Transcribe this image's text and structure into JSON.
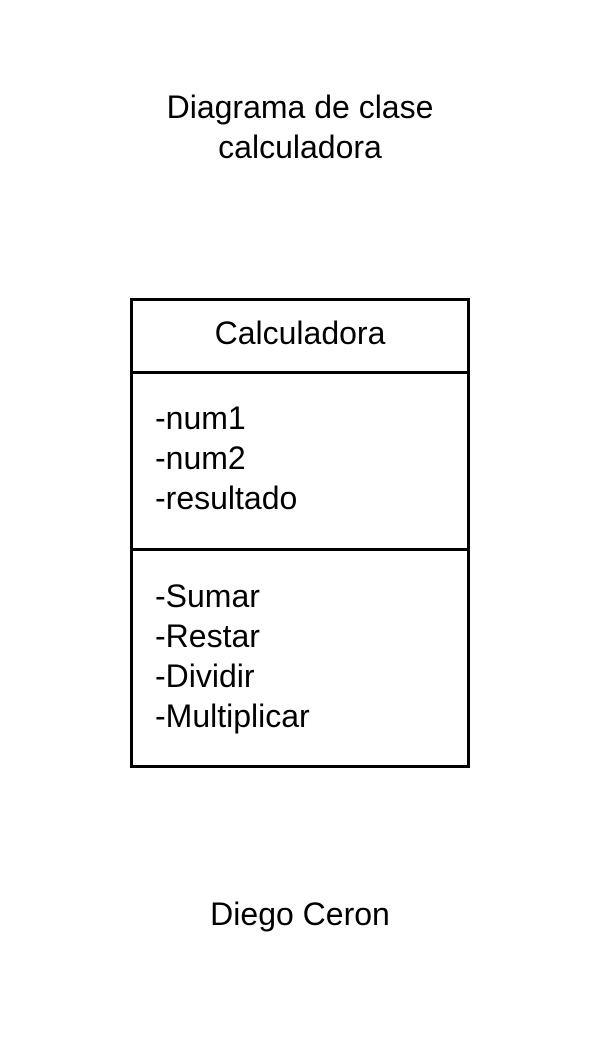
{
  "title": {
    "line1": "Diagrama de clase",
    "line2": "calculadora"
  },
  "class_box": {
    "name": "Calculadora",
    "attributes": [
      "-num1",
      "-num2",
      "-resultado"
    ],
    "methods": [
      "-Sumar",
      "-Restar",
      "-Dividir",
      "-Multiplicar"
    ]
  },
  "author": "Diego Ceron",
  "colors": {
    "stroke": "#000000",
    "background": "#ffffff",
    "text": "#000000"
  }
}
